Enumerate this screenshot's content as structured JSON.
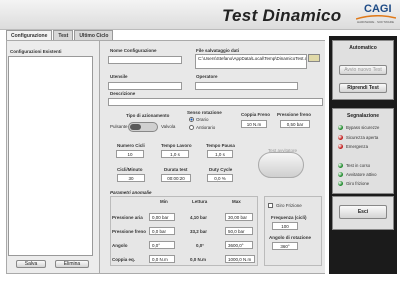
{
  "header": {
    "title": "Test Dinamico",
    "logo_text": "CAGI",
    "logo_sub": "HARDWARE · SOFTWARE"
  },
  "tabs": [
    {
      "label": "Configurazione"
    },
    {
      "label": "Test"
    },
    {
      "label": "Ultimo Ciclo"
    }
  ],
  "left": {
    "list_label": "Configurazioni Esistenti",
    "save": "Salva",
    "delete": "Elimina"
  },
  "form": {
    "nome_label": "Nome Configurazione",
    "nome_value": "",
    "file_label": "File salvataggio dati",
    "file_value": "C:\\Users\\Stefano\\AppData\\Local\\Temp\\DinamicoTest.csv",
    "utensile_label": "Utensile",
    "utensile_value": "",
    "operatore_label": "Operatore",
    "operatore_value": "",
    "descrizione_label": "Descrizione",
    "descrizione_value": "",
    "tipo_label": "Tipo di azionamento",
    "tipo_left": "Pulsante",
    "tipo_right": "Valvola",
    "senso_label": "Senso rotazione",
    "senso_orario": "Orario",
    "senso_antiorario": "Antiorario",
    "coppia_label": "Coppia Freno",
    "coppia_value": "10 N.m",
    "pressione_label": "Pressione freno",
    "pressione_value": "0,50 bar",
    "cicli_label": "Numero Cicli",
    "cicli_value": "10",
    "lavoro_label": "Tempo Lavoro",
    "lavoro_value": "1,0 s",
    "pausa_label": "Tempo Pausa",
    "pausa_value": "1,0 s",
    "cicli_min_label": "Cicli/Minuto",
    "cicli_min_value": "30",
    "durata_label": "Durata test",
    "durata_value": "00:00:20",
    "duty_label": "Duty Cycle",
    "duty_value": "0,0 %",
    "test_avv_label": "Test avvitatore"
  },
  "params": {
    "title": "Parametri anomalie",
    "headers": [
      "Min",
      "Lettura",
      "Max"
    ],
    "rows": [
      {
        "label": "Pressione aria",
        "min": "0,00 bar",
        "read": "4,10 bar",
        "max": "30,00 bar"
      },
      {
        "label": "Pressione freno",
        "min": "0,0 bar",
        "read": "33,2 bar",
        "max": "50,0 bar"
      },
      {
        "label": "Angolo",
        "min": "0,0°",
        "read": "0,0°",
        "max": "3600,0°"
      },
      {
        "label": "Coppia eq.",
        "min": "0,0 N.m",
        "read": "0,0 N.m",
        "max": "1000,0 N.m"
      }
    ]
  },
  "giri": {
    "check_label": "Giro Frizione",
    "freq_label": "Frequenza (cicli)",
    "freq_value": "100",
    "angolo_label": "Angolo di rotazione",
    "angolo_value": "360°"
  },
  "right": {
    "auto_title": "Automatico",
    "avvio_label": "Avvio nuovo Test",
    "ripr_label": "Riprendi Test",
    "seg_title": "Segnalazione",
    "signals": [
      {
        "label": "Bypass sicurezze",
        "color": "#1f8a2c"
      },
      {
        "label": "Sicurezza aperta",
        "color": "#c01c1c"
      },
      {
        "label": "Emergenza",
        "color": "#c01c1c"
      },
      {
        "label": "Test in corso",
        "color": "#1f8a2c"
      },
      {
        "label": "Avvitatore attivo",
        "color": "#1f8a2c"
      },
      {
        "label": "Giro frizione",
        "color": "#1f8a2c"
      }
    ],
    "exit_label": "Esci"
  }
}
